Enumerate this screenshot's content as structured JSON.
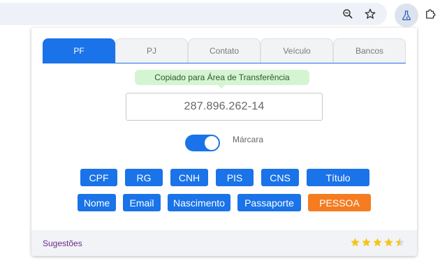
{
  "browser": {
    "icons": [
      "zoom-icon",
      "star-icon",
      "extension-active-icon",
      "puzzle-icon"
    ]
  },
  "tabs": [
    {
      "label": "PF",
      "active": true
    },
    {
      "label": "PJ",
      "active": false
    },
    {
      "label": "Contato",
      "active": false
    },
    {
      "label": "Veículo",
      "active": false
    },
    {
      "label": "Bancos",
      "active": false
    }
  ],
  "tooltip": "Copiado para Área de Transferência",
  "result_value": "287.896.262-14",
  "toggle": {
    "label": "Márcara",
    "on": true
  },
  "buttons_row1": [
    "CPF",
    "RG",
    "CNH",
    "PIS",
    "CNS",
    "Título"
  ],
  "buttons_row2": [
    "Nome",
    "Email",
    "Nascimento",
    "Passaporte",
    "PESSOA"
  ],
  "footer": {
    "suggest_label": "Sugestões",
    "rating": 4.5
  },
  "colors": {
    "accent": "#1a73e8",
    "highlight": "#f57c20",
    "tooltip_bg": "#d5f5d2",
    "star": "#f5c518"
  }
}
